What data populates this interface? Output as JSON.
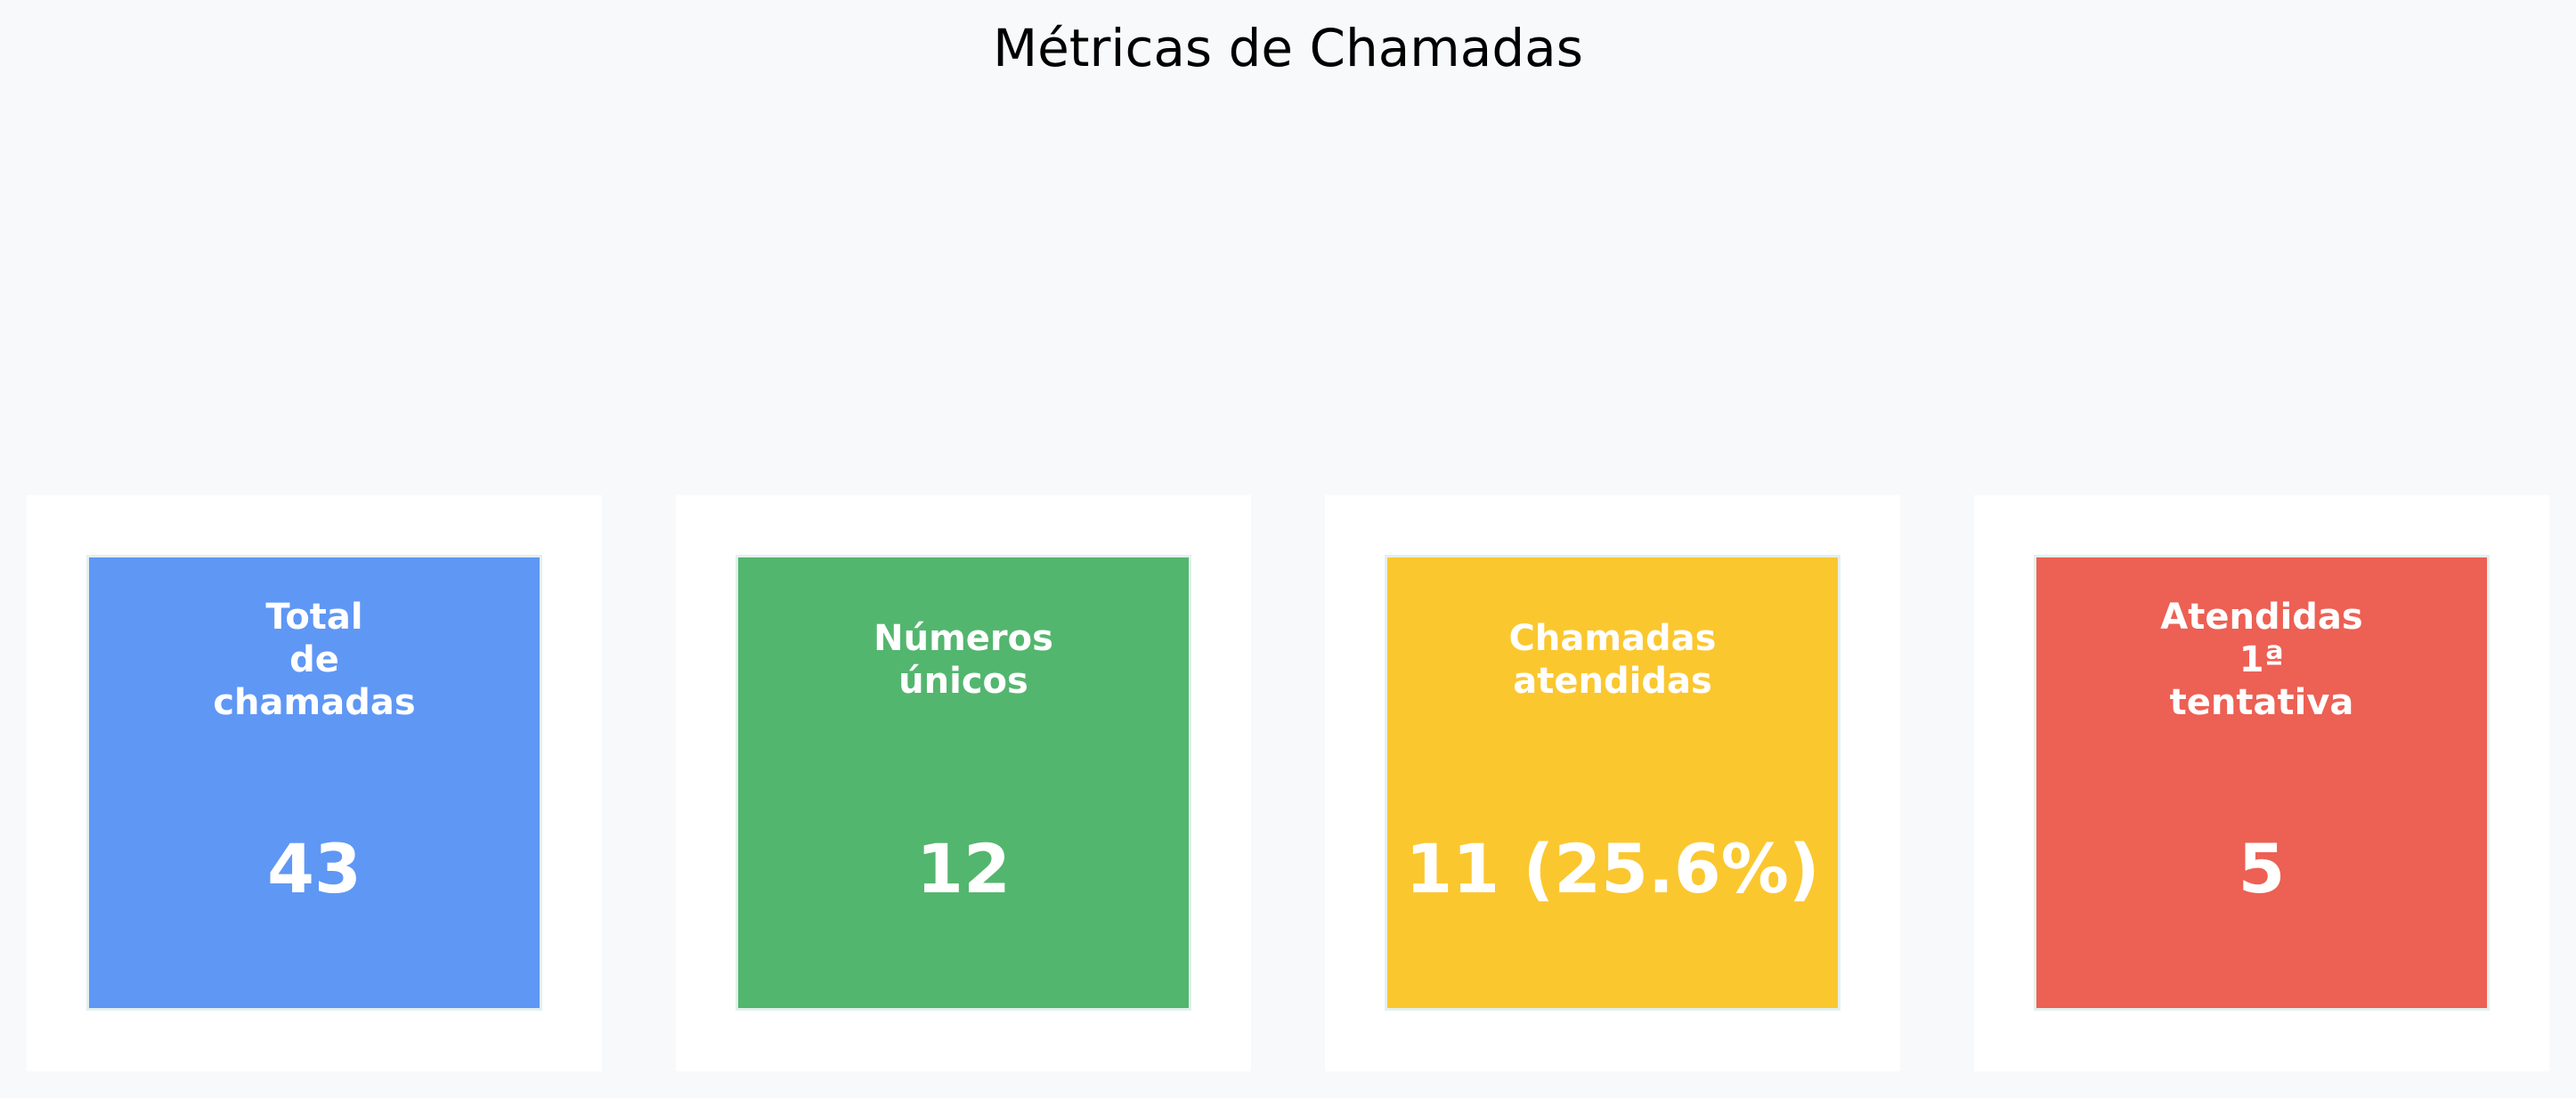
{
  "chart_data": {
    "type": "table",
    "title": "Métricas de Chamadas",
    "cards": [
      {
        "label": "Total\nde\nchamadas",
        "value": "43",
        "color": "#5f97f5"
      },
      {
        "label": "Números\núnicos",
        "value": "12",
        "color": "#53b66e"
      },
      {
        "label": "Chamadas\natendidas",
        "value": "11 (25.6%)",
        "color": "#fbc72f"
      },
      {
        "label": "Atendidas\n1ª\ntentativa",
        "value": "5",
        "color": "#ed6054"
      }
    ]
  }
}
